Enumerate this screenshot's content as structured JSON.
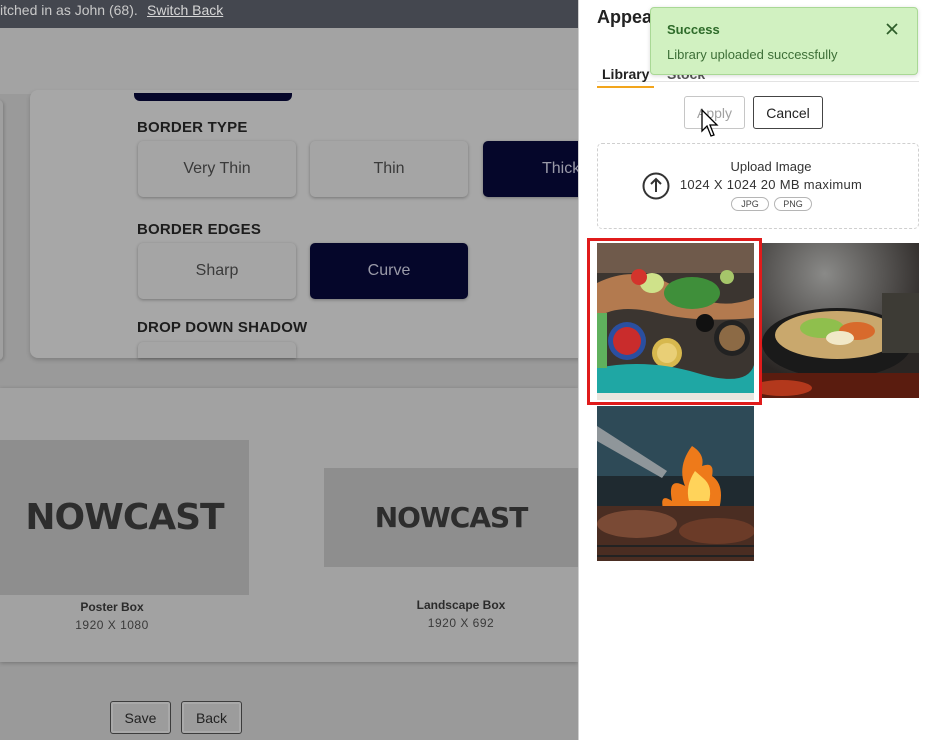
{
  "topbar": {
    "impersonation_prefix": "itched in as John (68).",
    "switch_back_link": "Switch Back"
  },
  "settings": {
    "border_type": {
      "label": "BORDER TYPE",
      "options": [
        "Very Thin",
        "Thin",
        "Thick"
      ],
      "selected": "Thick"
    },
    "border_edges": {
      "label": "BORDER EDGES",
      "options": [
        "Sharp",
        "Curve"
      ],
      "selected": "Curve"
    },
    "drop_down_shadow": {
      "label": "DROP DOWN SHADOW"
    }
  },
  "preview": {
    "logo_text": "NOWCAST",
    "boxes": [
      {
        "title": "Poster Box",
        "size": "1920 X 1080"
      },
      {
        "title": "Landscape Box",
        "size": "1920 X 692"
      }
    ]
  },
  "footer": {
    "save_label": "Save",
    "back_label": "Back"
  },
  "panel": {
    "title": "Appearance",
    "tabs": [
      {
        "label": "Library",
        "active": true
      },
      {
        "label": "Stock",
        "active": false
      }
    ],
    "apply_label": "Apply",
    "cancel_label": "Cancel",
    "upload": {
      "title": "Upload Image",
      "subtitle": "1024 X 1024 20 MB maximum",
      "formats": [
        "JPG",
        "PNG"
      ]
    },
    "images": [
      {
        "name": "cooking-table-photo",
        "selected": true
      },
      {
        "name": "wok-vegetables-photo",
        "selected": false
      },
      {
        "name": "grill-fire-photo",
        "selected": false
      }
    ]
  },
  "toast": {
    "title": "Success",
    "message": "Library uploaded successfully",
    "accent": "#d1f1c1"
  },
  "colors": {
    "selected_option": "#05062a",
    "tab_accent": "#f2a51c",
    "selection_border": "#e01b1b"
  }
}
